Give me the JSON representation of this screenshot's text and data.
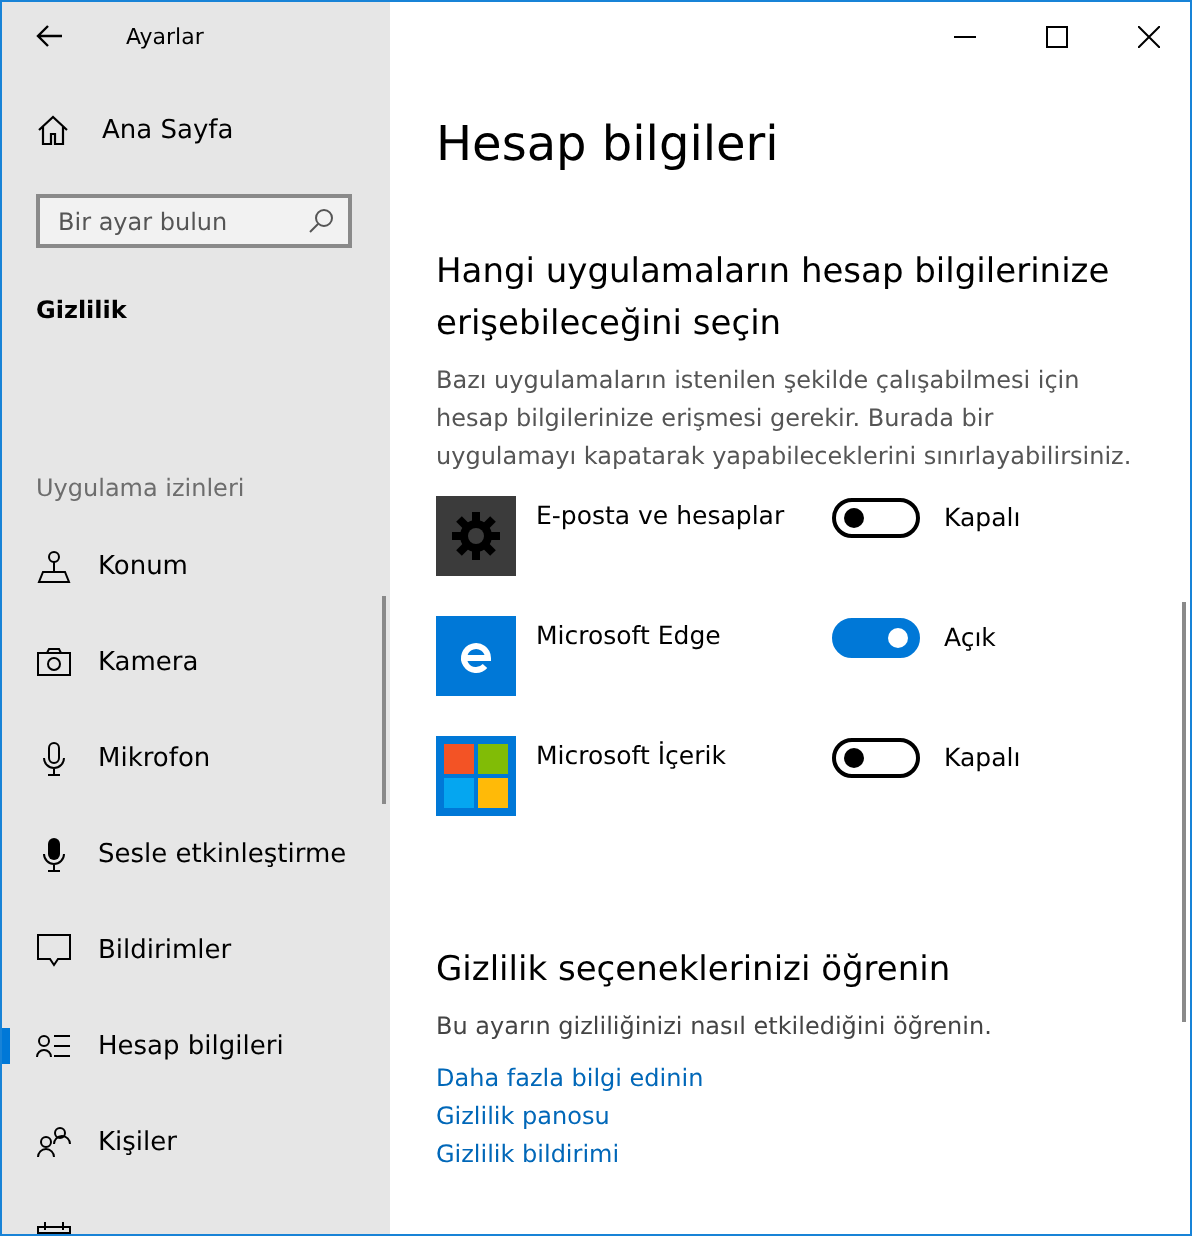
{
  "window": {
    "title": "Ayarlar"
  },
  "sidebar": {
    "home": "Ana Sayfa",
    "search": {
      "placeholder": "Bir ayar bulun"
    },
    "category": "Gizlilik",
    "group": "Uygulama izinleri",
    "items": [
      {
        "label": "Konum",
        "kind": "location",
        "selected": false
      },
      {
        "label": "Kamera",
        "kind": "camera",
        "selected": false
      },
      {
        "label": "Mikrofon",
        "kind": "mic",
        "selected": false
      },
      {
        "label": "Sesle etkinleştirme",
        "kind": "voice",
        "selected": false
      },
      {
        "label": "Bildirimler",
        "kind": "notify",
        "selected": false
      },
      {
        "label": "Hesap bilgileri",
        "kind": "account",
        "selected": true
      },
      {
        "label": "Kişiler",
        "kind": "people",
        "selected": false
      },
      {
        "kind": "calendar",
        "selected": false
      }
    ]
  },
  "page": {
    "title": "Hesap bilgileri",
    "section": "Hangi uygulamaların hesap bilgilerinize erişebileceğini seçin",
    "description": "Bazı uygulamaların istenilen şekilde çalışabilmesi için hesap bilgilerinize erişmesi gerekir. Burada bir uygulamayı kapatarak yapabileceklerini sınırlayabilirsiniz.",
    "apps": [
      {
        "name": "E-posta ve hesaplar",
        "kind": "mail",
        "on": false,
        "state": "Kapalı"
      },
      {
        "name": "Microsoft Edge",
        "kind": "browser",
        "on": true,
        "state": "Açık"
      },
      {
        "name": "Microsoft İçerik",
        "kind": "content",
        "on": false,
        "state": "Kapalı"
      }
    ],
    "privacy": {
      "title": "Gizlilik seçeneklerinizi öğrenin",
      "text": "Bu ayarın gizliliğinizi nasıl etkilediğini öğrenin.",
      "links": [
        "Daha fazla bilgi edinin",
        "Gizlilik panosu",
        "Gizlilik bildirimi"
      ]
    }
  }
}
